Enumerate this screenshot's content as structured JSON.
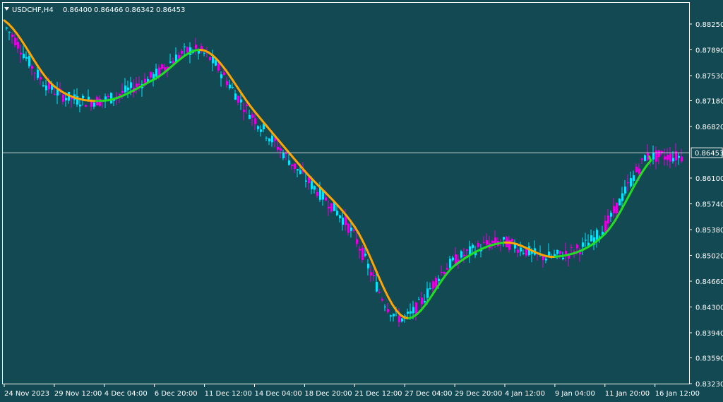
{
  "header": {
    "symbol_label": "USDCHF,H4",
    "ohlc": [
      "0.86400",
      "0.86466",
      "0.86342",
      "0.86453"
    ],
    "dropdown_icon": "triangle-down-icon"
  },
  "colors": {
    "background": "#134953",
    "frame": "#ffffff",
    "bull_candle": "#00e5ff",
    "bear_candle": "#e000e0",
    "ma_rising": "#22dd22",
    "ma_falling": "#ffa500",
    "price_line": "#c6d3d6"
  },
  "current_price": {
    "label": "0.86453",
    "value": 0.86453
  },
  "chart_data": {
    "type": "candlestick",
    "symbol": "USDCHF",
    "timeframe": "H4",
    "ylim": [
      0.8323,
      0.8843
    ],
    "y_ticks": [
      "0.88250",
      "0.87890",
      "0.87530",
      "0.87180",
      "0.86820",
      "0.86100",
      "0.85740",
      "0.85380",
      "0.85020",
      "0.84660",
      "0.84300",
      "0.83940",
      "0.83590",
      "0.83230"
    ],
    "x_ticks": [
      "24 Nov 2023",
      "29 Nov 12:00",
      "4 Dec 04:00",
      "6 Dec 20:00",
      "11 Dec 12:00",
      "14 Dec 04:00",
      "18 Dec 20:00",
      "21 Dec 12:00",
      "27 Dec 04:00",
      "29 Dec 20:00",
      "4 Jan 12:00",
      "9 Jan 04:00",
      "11 Jan 20:00",
      "16 Jan 12:00"
    ],
    "grid": false,
    "series": [
      {
        "type": "moving-average",
        "style": "two-color (green when rising, orange when falling)",
        "x": [
          "24 Nov 2023",
          "29 Nov 12:00",
          "4 Dec 04:00",
          "6 Dec 20:00",
          "11 Dec 12:00",
          "14 Dec 04:00",
          "18 Dec 20:00",
          "21 Dec 12:00",
          "27 Dec 04:00",
          "29 Dec 20:00",
          "4 Jan 12:00",
          "9 Jan 04:00",
          "11 Jan 20:00",
          "16 Jan 12:00"
        ],
        "values": [
          0.883,
          0.8738,
          0.8718,
          0.8748,
          0.8788,
          0.8703,
          0.862,
          0.8542,
          0.8415,
          0.8488,
          0.852,
          0.85,
          0.8532,
          0.864
        ]
      }
    ],
    "ohlc_approx": {
      "first_bar": {
        "x": "24 Nov 2023",
        "open": 0.8826,
        "close": 0.8818
      },
      "lowest_low": 0.8337,
      "highest_high": 0.8832,
      "last_bar": {
        "x": "16 Jan 12:00",
        "open": 0.864,
        "high": 0.86466,
        "low": 0.86342,
        "close": 0.86453
      }
    }
  }
}
